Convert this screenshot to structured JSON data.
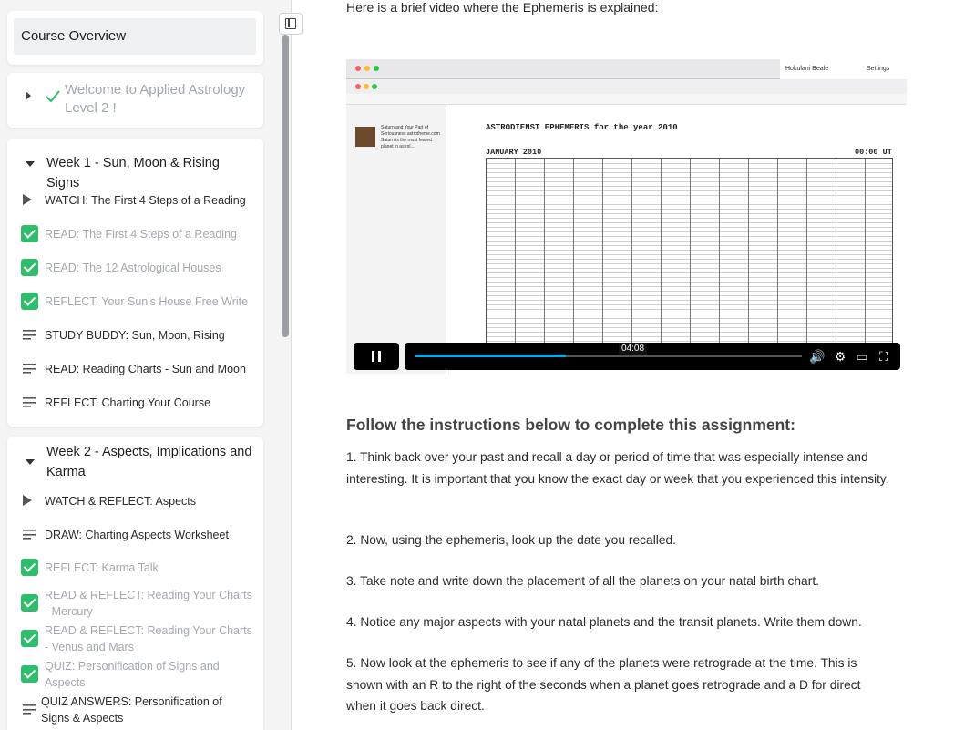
{
  "sidebar": {
    "overview_label": "Course Overview",
    "welcome": {
      "title": "Welcome to Applied Astrology Level 2 !"
    },
    "weeks": [
      {
        "title": "Week 1 - Sun, Moon & Rising Signs",
        "items": [
          {
            "type": "video",
            "done": false,
            "label": "WATCH: The First 4 Steps of a Reading"
          },
          {
            "type": "text",
            "done": true,
            "label": "READ: The First 4 Steps of a Reading"
          },
          {
            "type": "text",
            "done": true,
            "label": "READ: The 12 Astrological Houses"
          },
          {
            "type": "text",
            "done": true,
            "label": "REFLECT: Your Sun's House Free Write"
          },
          {
            "type": "text",
            "done": false,
            "label": "STUDY BUDDY: Sun, Moon, Rising"
          },
          {
            "type": "text",
            "done": false,
            "label": "READ: Reading Charts - Sun and Moon"
          },
          {
            "type": "text",
            "done": false,
            "label": "REFLECT: Charting Your Course"
          }
        ]
      },
      {
        "title": "Week 2 - Aspects, Implications and Karma",
        "items": [
          {
            "type": "video",
            "done": false,
            "label": "WATCH & REFLECT: Aspects"
          },
          {
            "type": "text",
            "done": false,
            "label": "DRAW: Charting Aspects Worksheet"
          },
          {
            "type": "text",
            "done": true,
            "label": "REFLECT: Karma Talk"
          },
          {
            "type": "text",
            "done": true,
            "label": "READ & REFLECT: Reading Your Charts - Mercury"
          },
          {
            "type": "text",
            "done": true,
            "label": "READ & REFLECT: Reading Your Charts - Venus and Mars"
          },
          {
            "type": "text",
            "done": true,
            "label": "QUIZ: Personification of Signs and Aspects"
          },
          {
            "type": "text",
            "done": false,
            "label": "QUIZ ANSWERS: Personification of Signs & Aspects"
          }
        ]
      }
    ]
  },
  "main": {
    "intro": "Here is a brief video where the Ephemeris is explained:",
    "video": {
      "current_time": "04:08",
      "progress": 0.39,
      "browser_profile": "Hokulani Beale",
      "browser_settings": "Settings",
      "ephemeris_title": "ASTRODIENST EPHEMERIS for the year 2010",
      "ephemeris_month": "JANUARY 2010",
      "ephemeris_time": "00:00 UT",
      "thumb_text": "Saturn and Your Part of Seriousness astrotheme.com Saturn is the most feared planet in astrol..."
    },
    "heading": "Follow the instructions below to complete this assignment:",
    "steps": [
      "1. Think back over your past and recall a day or period of time that was especially intense and interesting. It is important that you know the exact day or week that you experienced this intensity.",
      "2. Now, using the ephemeris, look up the date you recalled.",
      "3. Take note and write down the placement of all the planets on your natal birth chart.",
      "4. Notice any major aspects with your natal planets and the transit planets. Write them down.",
      "5. Now look at the ephemeris to see if any of the planets were retrograde at the time. This is shown with an R to the right of the seconds when a planet goes retrograde and a D for direct when it goes back direct."
    ]
  }
}
